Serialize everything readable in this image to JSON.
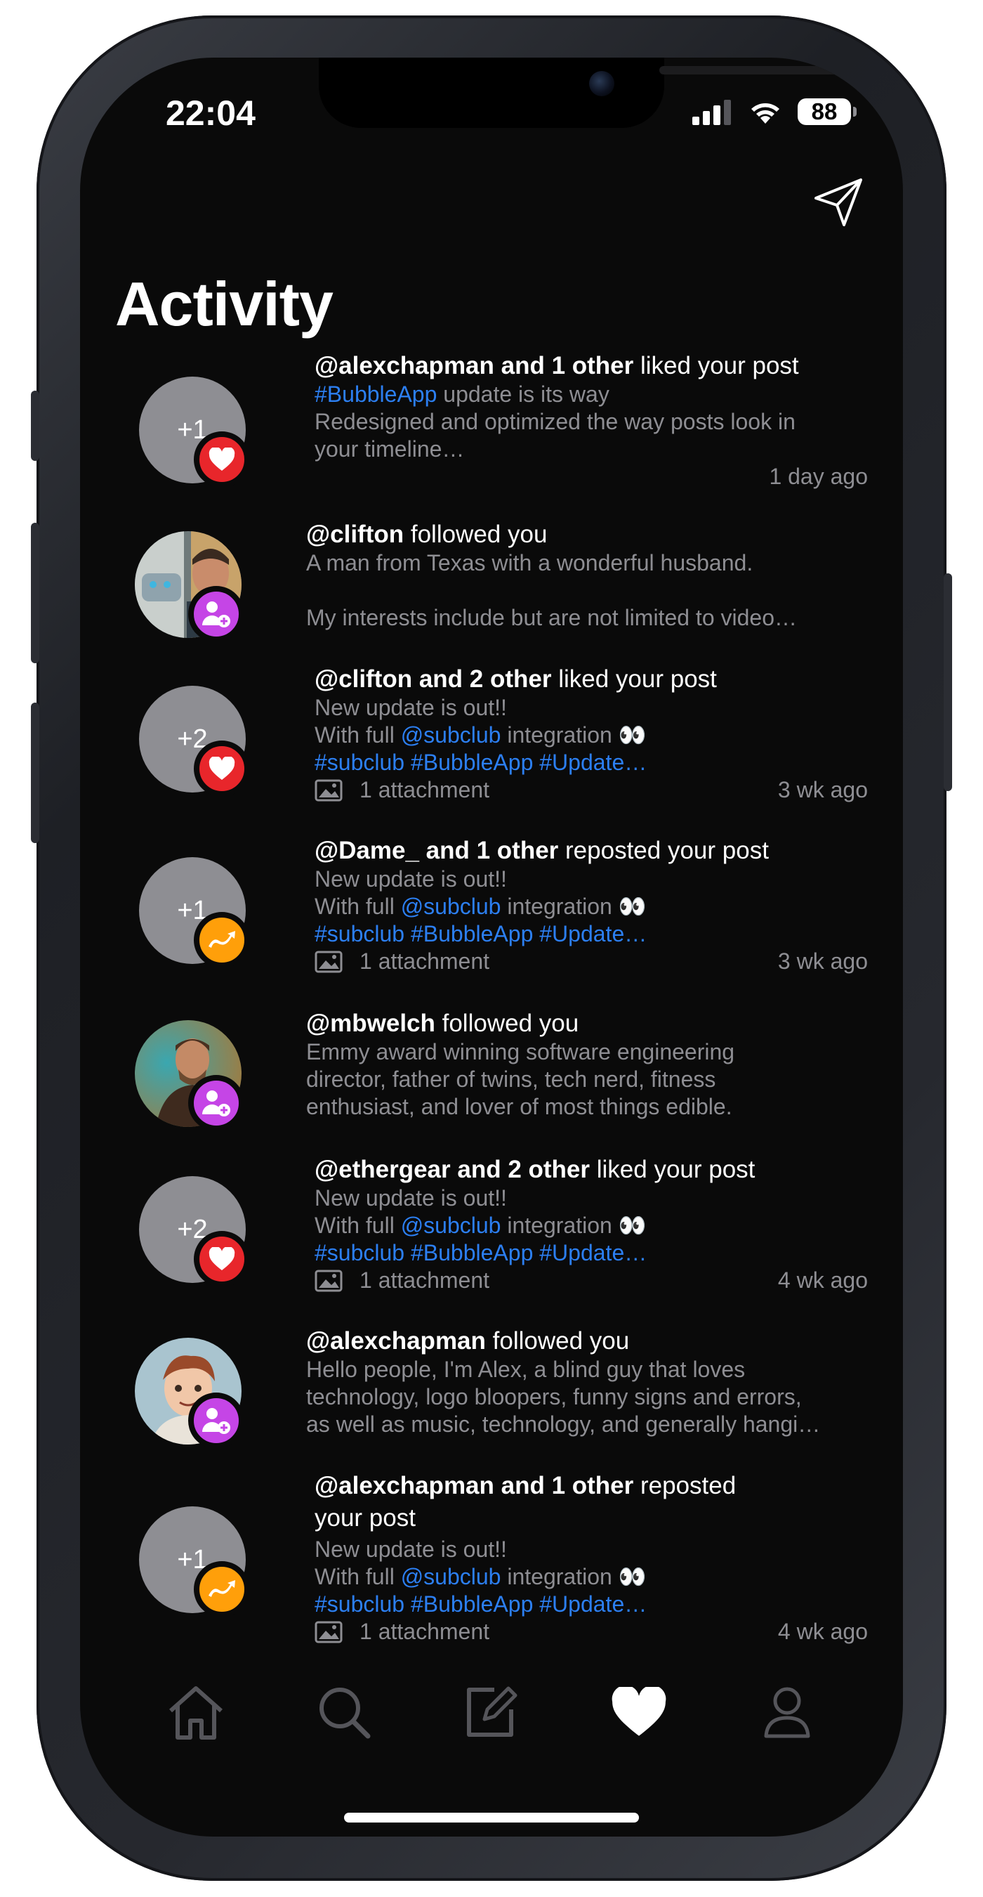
{
  "status_bar": {
    "time": "22:04",
    "battery": "88"
  },
  "header": {
    "title": "Activity"
  },
  "feed": [
    {
      "type": "like",
      "count": "+1",
      "actor": "@alexchapman and 1 other",
      "action": " liked your post",
      "line1_link": "#BubbleApp",
      "line1_rest": " update is its way",
      "line2": "Redesigned and optimized the way posts look in",
      "line3": "your timeline…",
      "time": "1 day ago"
    },
    {
      "type": "follow",
      "actor": "@clifton",
      "action": " followed you",
      "line1": "A man from Texas with a wonderful husband.",
      "line2": "",
      "line3": "My interests include but are not limited to video…"
    },
    {
      "type": "like",
      "count": "+2",
      "actor": "@clifton and 2 other",
      "action": " liked your post",
      "body1": "New update is out!!",
      "body2_pre": "With full ",
      "body2_link": "@subclub",
      "body2_post": " integration 👀",
      "tags": "#subclub #BubbleApp #Update…",
      "attachment": "1 attachment",
      "time": "3 wk ago"
    },
    {
      "type": "repost",
      "count": "+1",
      "actor": "@Dame_ and 1 other",
      "action": " reposted your post",
      "body1": "New update is out!!",
      "body2_pre": "With full ",
      "body2_link": "@subclub",
      "body2_post": " integration 👀",
      "tags": "#subclub #BubbleApp #Update…",
      "attachment": "1 attachment",
      "time": "3 wk ago"
    },
    {
      "type": "follow",
      "actor": "@mbwelch",
      "action": " followed you",
      "line1": "Emmy award winning software engineering",
      "line2": "director, father of twins, tech nerd, fitness",
      "line3": "enthusiast, and lover of most things edible."
    },
    {
      "type": "like",
      "count": "+2",
      "actor": "@ethergear and 2 other",
      "action": " liked your post",
      "body1": "New update is out!!",
      "body2_pre": "With full ",
      "body2_link": "@subclub",
      "body2_post": " integration 👀",
      "tags": "#subclub #BubbleApp #Update…",
      "attachment": "1 attachment",
      "time": "4 wk ago"
    },
    {
      "type": "follow",
      "actor": "@alexchapman",
      "action": " followed you",
      "line1": "Hello people, I'm Alex, a blind guy that loves",
      "line2": "technology, logo bloopers, funny signs and errors,",
      "line3": "as well as music, technology, and generally hangi…"
    },
    {
      "type": "repost",
      "count": "+1",
      "actor": "@alexchapman and 1 other",
      "action": " reposted",
      "action2": "your post",
      "body1": "New update is out!!",
      "body2_pre": "With full ",
      "body2_link": "@subclub",
      "body2_post": " integration 👀",
      "tags": "#subclub #BubbleApp #Update…",
      "attachment": "1 attachment",
      "time": "4 wk ago"
    }
  ],
  "tab_bar": {
    "icons": [
      "home-icon",
      "search-icon",
      "compose-icon",
      "heart-icon",
      "profile-icon"
    ],
    "active": "heart-icon"
  },
  "colors": {
    "background": "#0a0a0a",
    "link": "#2c7ff2",
    "like": "#e8262b",
    "repost": "#ff9f0a",
    "follow": "#c545e6",
    "muted": "#8e8e93"
  }
}
